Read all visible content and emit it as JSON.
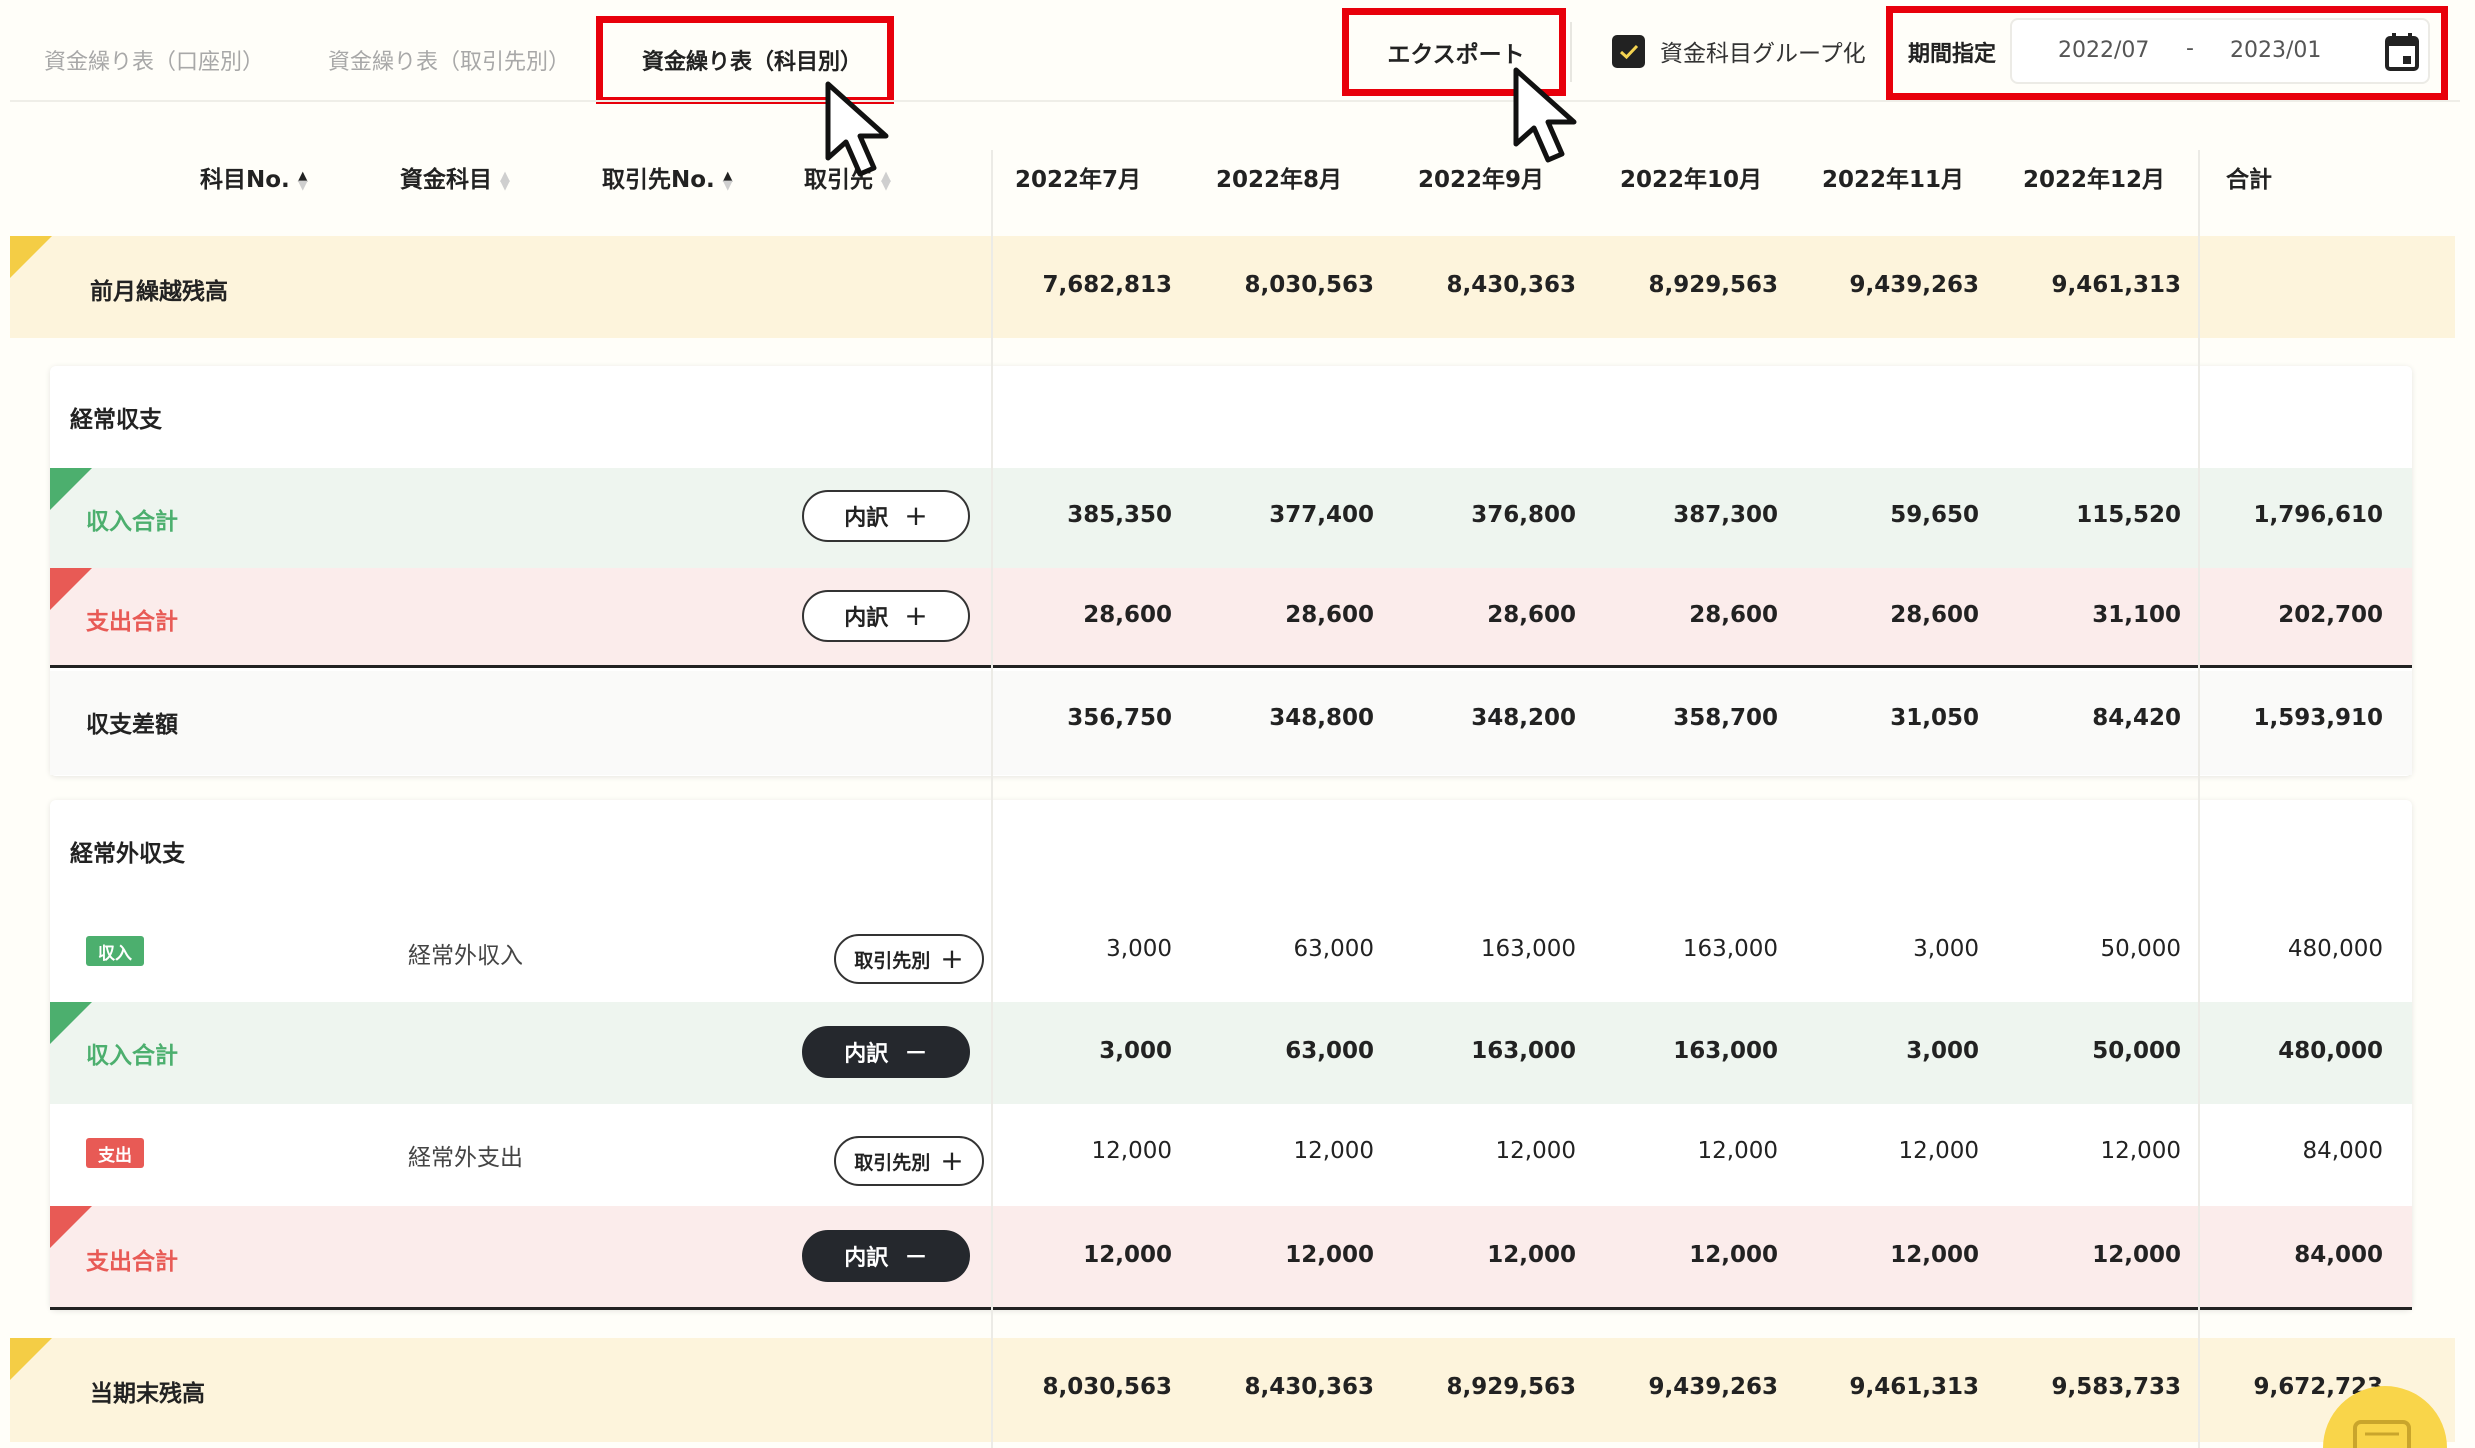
{
  "tabs": [
    {
      "label": "資金繰り表（口座別）",
      "active": false
    },
    {
      "label": "資金繰り表（取引先別）",
      "active": false
    },
    {
      "label": "資金繰り表（科目別）",
      "active": true
    }
  ],
  "toolbar": {
    "export_label": "エクスポート",
    "group_checkbox_label": "資金科目グループ化",
    "group_checked": true,
    "period_label": "期間指定",
    "date_from": "2022/07",
    "date_sep": "-",
    "date_to": "2023/01"
  },
  "columns": {
    "account_no": "科目No.",
    "account": "資金科目",
    "partner_no": "取引先No.",
    "partner": "取引先",
    "months": [
      "2022年7月",
      "2022年8月",
      "2022年9月",
      "2022年10月",
      "2022年11月",
      "2022年12月"
    ],
    "total": "合計"
  },
  "opening_balance": {
    "label": "前月繰越残高",
    "values": [
      "7,682,813",
      "8,030,563",
      "8,430,363",
      "8,929,563",
      "9,439,263",
      "9,461,313"
    ],
    "total": ""
  },
  "operating": {
    "title": "経常収支",
    "income_total": {
      "label": "収入合計",
      "button": "内訳",
      "button_symbol": "+",
      "values": [
        "385,350",
        "377,400",
        "376,800",
        "387,300",
        "59,650",
        "115,520"
      ],
      "total": "1,796,610"
    },
    "expense_total": {
      "label": "支出合計",
      "button": "内訳",
      "button_symbol": "+",
      "values": [
        "28,600",
        "28,600",
        "28,600",
        "28,600",
        "28,600",
        "31,100"
      ],
      "total": "202,700"
    },
    "difference": {
      "label": "収支差額",
      "values": [
        "356,750",
        "348,800",
        "348,200",
        "358,700",
        "31,050",
        "84,420"
      ],
      "total": "1,593,910"
    }
  },
  "non_operating": {
    "title": "経常外収支",
    "income_item": {
      "badge": "収入",
      "account": "経常外収入",
      "button": "取引先別",
      "button_symbol": "+",
      "values": [
        "3,000",
        "63,000",
        "163,000",
        "163,000",
        "3,000",
        "50,000"
      ],
      "total": "480,000"
    },
    "income_total": {
      "label": "収入合計",
      "button": "内訳",
      "button_symbol": "−",
      "values": [
        "3,000",
        "63,000",
        "163,000",
        "163,000",
        "3,000",
        "50,000"
      ],
      "total": "480,000"
    },
    "expense_item": {
      "badge": "支出",
      "account": "経常外支出",
      "button": "取引先別",
      "button_symbol": "+",
      "values": [
        "12,000",
        "12,000",
        "12,000",
        "12,000",
        "12,000",
        "12,000"
      ],
      "total": "84,000"
    },
    "expense_total": {
      "label": "支出合計",
      "button": "内訳",
      "button_symbol": "−",
      "values": [
        "12,000",
        "12,000",
        "12,000",
        "12,000",
        "12,000",
        "12,000"
      ],
      "total": "84,000"
    }
  },
  "closing_balance": {
    "label": "当期末残高",
    "values": [
      "8,030,563",
      "8,430,363",
      "8,929,563",
      "9,439,263",
      "9,461,313",
      "9,583,733"
    ],
    "total": "9,672,723"
  },
  "colors": {
    "highlight": "#e8000b",
    "income": "#4caf6e",
    "expense": "#e85a55",
    "income_bg": "#eef5ef",
    "expense_bg": "#fbeceb",
    "balance_bg": "#fdf4dc",
    "balance_tri": "#f4cd45"
  },
  "icons": [
    "calendar-icon",
    "check-icon",
    "mouse-cursor-icon",
    "chat-icon"
  ]
}
